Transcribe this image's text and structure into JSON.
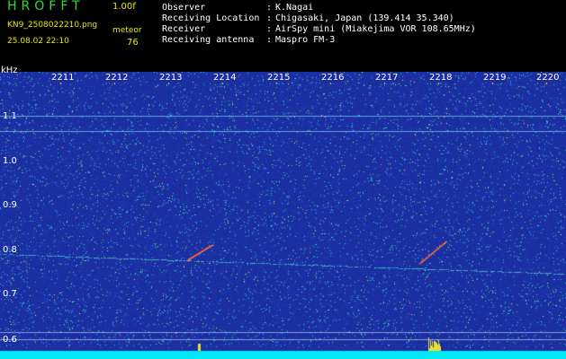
{
  "header": {
    "app_title": "HROFFT",
    "version": "1.00f",
    "filename": "KN9_2508022210.png",
    "datetime": "25.08.02 22:10",
    "count_label": "meteor",
    "count_value": "76",
    "info": [
      {
        "label": "Observer",
        "sep": ":",
        "value": "K.Nagai"
      },
      {
        "label": "Receiving Location",
        "sep": ":",
        "value": "Chigasaki, Japan (139.414 35.340)"
      },
      {
        "label": "Receiver",
        "sep": ":",
        "value": "AirSpy mini (Miakejima VOR 108.65MHz)"
      },
      {
        "label": "Receiving antenna",
        "sep": ":",
        "value": "Maspro FM-3"
      }
    ]
  },
  "spectrogram": {
    "y_unit": "kHz",
    "y_ticks": [
      "1.1",
      "1.0",
      "0.9",
      "0.8",
      "0.7",
      "0.6"
    ],
    "x_ticks": [
      "2211",
      "2212",
      "2213",
      "2214",
      "2215",
      "2216",
      "2217",
      "2218",
      "2219",
      "2220"
    ],
    "colors": {
      "background": "#1b2fa3",
      "noise_cyan": "#22c8e8",
      "noise_green": "#22d07a",
      "noise_yellow": "#e8e030",
      "signal_red": "#ff3030",
      "baseline": "#00e8f8",
      "gridline": "#ffffff"
    }
  }
}
